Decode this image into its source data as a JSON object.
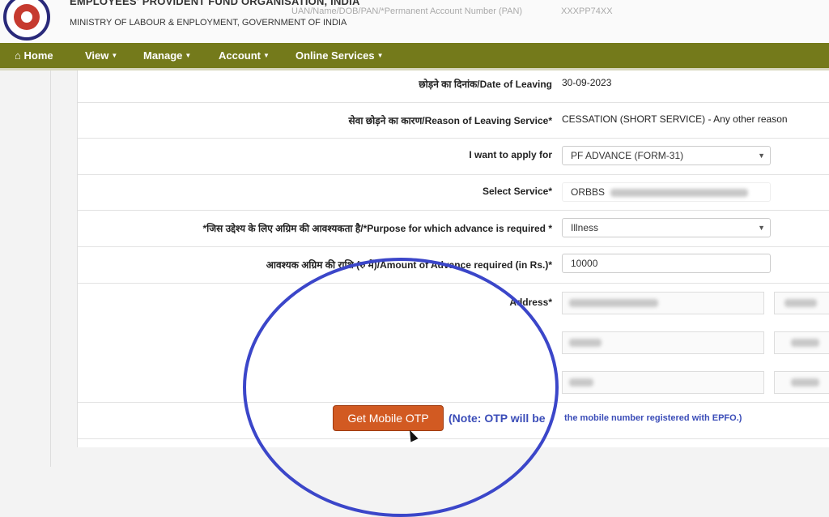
{
  "header": {
    "org_name": "EMPLOYEES' PROVIDENT FUND ORGANISATION, INDIA",
    "ministry": "MINISTRY OF LABOUR & ENPLOYMENT, GOVERNMENT OF INDIA",
    "pan_label": "UAN/Name/DOB/PAN/*Permanent Account Number (PAN)",
    "pan_value": "XXXPP74XX"
  },
  "nav": {
    "home": "Home",
    "view": "View",
    "manage": "Manage",
    "account": "Account",
    "online_services": "Online Services"
  },
  "form": {
    "date_of_leaving_label": "छोड़ने का दिनांक/Date of Leaving",
    "date_of_leaving_value": "30-09-2023",
    "reason_label": "सेवा छोड़ने का कारण/Reason of Leaving Service*",
    "reason_value": "CESSATION (SHORT SERVICE) - Any other reason",
    "apply_label": "I want to apply for",
    "apply_value": "PF ADVANCE (FORM-31)",
    "service_label": "Select Service*",
    "service_value": "ORBBS",
    "purpose_label": "*जिस उद्देश्य के लिए अग्रिम की आवश्यकता है/*Purpose for which advance is required *",
    "purpose_value": "Illness",
    "amount_label": "आवश्यक अग्रिम की राशि (रु में)/Amount of Advance required (in Rs.)*",
    "amount_value": "10000",
    "address_label": "Address*"
  },
  "otp": {
    "button": "Get Mobile OTP",
    "note_part1": "(Note: OTP will be",
    "note_part2": "the mobile number registered with EPFO.)"
  },
  "colors": {
    "navbar": "#747a1b",
    "otp_button": "#d25a22",
    "highlight_circle": "#3b46c9"
  }
}
